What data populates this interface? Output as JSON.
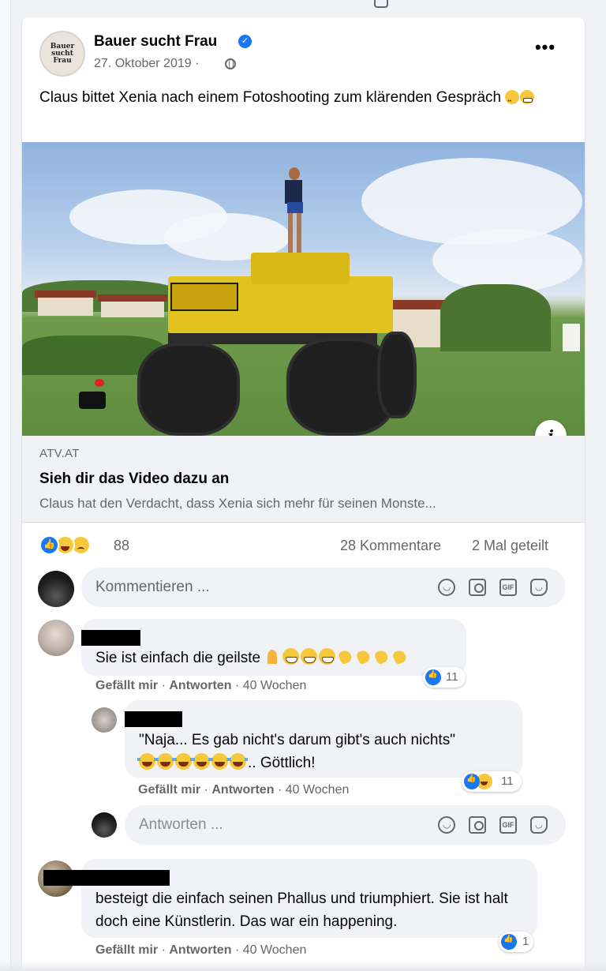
{
  "post": {
    "page_name": "Bauer sucht Frau",
    "avatar_text": [
      "Bauer",
      "sucht",
      "Frau"
    ],
    "date": "27. Oktober 2019 ·",
    "text": "Claus bittet Xenia nach einem Fotoshooting zum klärenden Gespräch",
    "text_emojis": [
      "sad-face-emoji",
      "grimace-face-emoji"
    ]
  },
  "link": {
    "domain": "ATV.AT",
    "title": "Sieh dir das Video dazu an",
    "description": "Claus hat den Verdacht, dass Xenia sich mehr für seinen Monste..."
  },
  "stats": {
    "reactions": [
      "like",
      "haha",
      "sad"
    ],
    "reaction_count": "88",
    "comments": "28 Kommentare",
    "shares": "2 Mal geteilt"
  },
  "composer": {
    "placeholder": "Kommentieren ...",
    "reply_placeholder": "Antworten ..."
  },
  "comments": [
    {
      "text": "Sie ist einfach die geilste",
      "emojis": [
        "pray",
        "grin",
        "grin",
        "grin",
        "wave",
        "wave",
        "wave",
        "wave"
      ],
      "like_label": "Gefällt mir",
      "reply_label": "Antworten",
      "age": "· 40 Wochen",
      "reactions": [
        "like"
      ],
      "reaction_count": "11"
    },
    {
      "line1": "\"Naja... Es gab nicht's darum gibt's auch nichts\"",
      "line2_suffix": ".. Göttlich!",
      "emojis": [
        "joy",
        "joy",
        "joy",
        "joy",
        "joy",
        "joy"
      ],
      "like_label": "Gefällt mir",
      "reply_label": "Antworten",
      "age": "· 40 Wochen",
      "reactions": [
        "like",
        "haha"
      ],
      "reaction_count": "11"
    },
    {
      "text": "besteigt die einfach seinen Phallus und triumphiert. Sie ist halt doch eine Künstlerin. Das war ein happening.",
      "like_label": "Gefällt mir",
      "reply_label": "Antworten",
      "age": "· 40 Wochen",
      "reactions": [
        "like"
      ],
      "reaction_count": "1"
    }
  ],
  "separators": {
    "dot": "·"
  },
  "colors": {
    "brand_blue": "#1877f2",
    "text_secondary": "#65676b",
    "bubble_bg": "#f0f2f5"
  }
}
